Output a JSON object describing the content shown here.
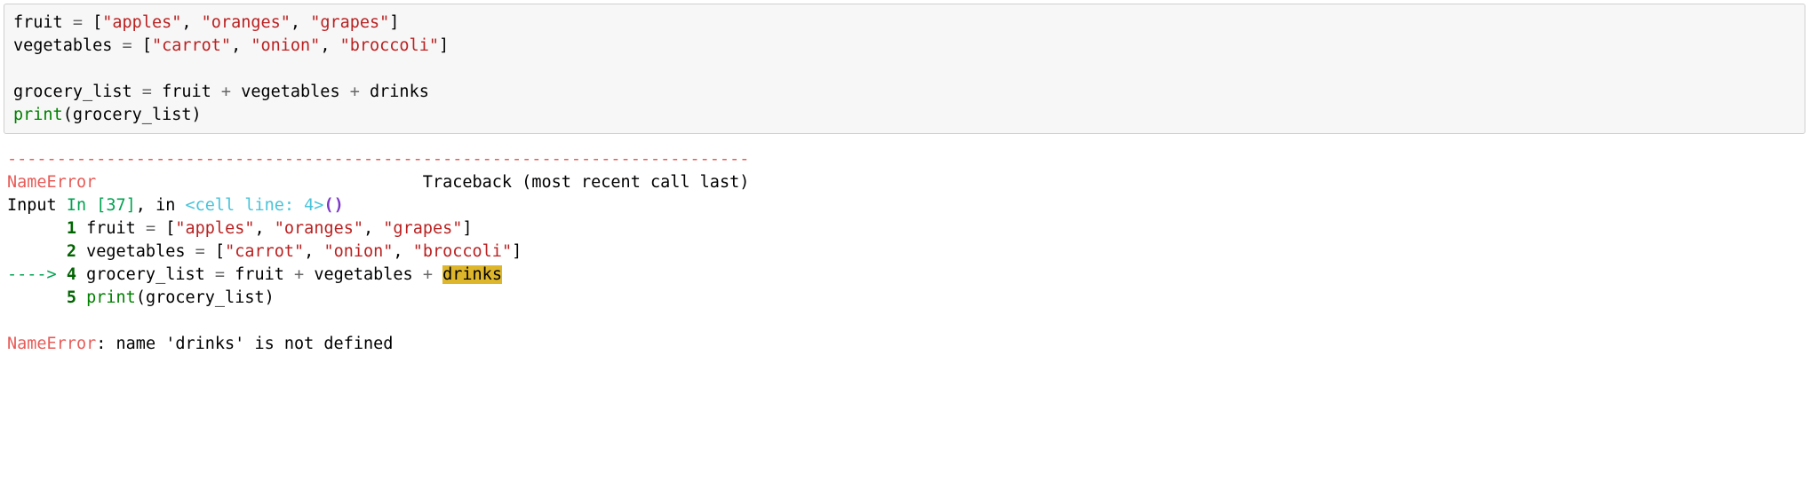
{
  "code": {
    "line1": {
      "fruit": "fruit",
      "eq": " = ",
      "lb": "[",
      "s1": "\"apples\"",
      "c1": ", ",
      "s2": "\"oranges\"",
      "c2": ", ",
      "s3": "\"grapes\"",
      "rb": "]"
    },
    "line2": {
      "veg": "vegetables",
      "eq": " = ",
      "lb": "[",
      "s1": "\"carrot\"",
      "c1": ", ",
      "s2": "\"onion\"",
      "c2": ", ",
      "s3": "\"broccoli\"",
      "rb": "]"
    },
    "line4": {
      "gl": "grocery_list",
      "eq": " = ",
      "f": "fruit",
      "p1": " + ",
      "v": "vegetables",
      "p2": " + ",
      "d": "drinks"
    },
    "line5": {
      "print": "print",
      "lp": "(",
      "arg": "grocery_list",
      "rp": ")"
    }
  },
  "tb": {
    "sep": "---------------------------------------------------------------------------",
    "err_name": "NameError",
    "trace_label": "                                 Traceback (most recent call last)",
    "input_word": "Input ",
    "in_label": "In [37]",
    "in_comma": ", in ",
    "cell_line": "<cell line: 4>",
    "parens": "()",
    "ln1": {
      "pad": "      ",
      "num": "1",
      "sp": " ",
      "fruit": "fruit",
      "eq": " = ",
      "lb": "[",
      "s1": "\"apples\"",
      "c1": ", ",
      "s2": "\"oranges\"",
      "c2": ", ",
      "s3": "\"grapes\"",
      "rb": "]"
    },
    "ln2": {
      "pad": "      ",
      "num": "2",
      "sp": " ",
      "veg": "vegetables",
      "eq": " = ",
      "lb": "[",
      "s1": "\"carrot\"",
      "c1": ", ",
      "s2": "\"onion\"",
      "c2": ", ",
      "s3": "\"broccoli\"",
      "rb": "]"
    },
    "ln4": {
      "arrow": "----> ",
      "num": "4",
      "sp": " ",
      "gl": "grocery_list",
      "eq": " = ",
      "f": "fruit",
      "p1": " + ",
      "v": "vegetables",
      "p2": " + ",
      "d": "drinks"
    },
    "ln5": {
      "pad": "      ",
      "num": "5",
      "sp": " ",
      "print": "print",
      "lp": "(",
      "arg": "grocery_list",
      "rp": ")"
    },
    "final_err": "NameError",
    "final_msg": ": name 'drinks' is not defined"
  }
}
